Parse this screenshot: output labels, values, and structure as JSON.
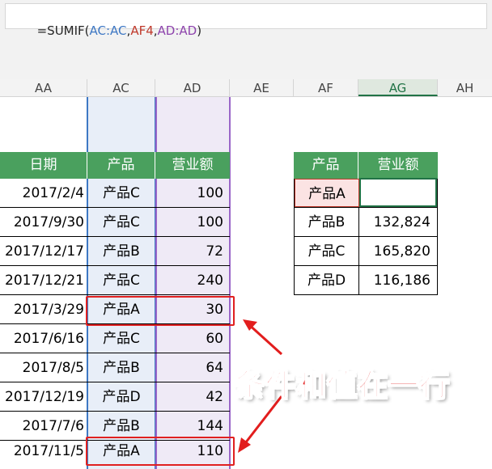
{
  "formula_bar": {
    "parts": [
      {
        "text": "=SUMIF(",
        "color": "#262626"
      },
      {
        "text": "AC:AC",
        "color": "#3e78c4"
      },
      {
        "text": ",",
        "color": "#262626"
      },
      {
        "text": "AF4",
        "color": "#c0392b"
      },
      {
        "text": ",",
        "color": "#262626"
      },
      {
        "text": "AD:AD",
        "color": "#8e44ad"
      },
      {
        "text": ")",
        "color": "#262626"
      }
    ]
  },
  "columns": [
    "AA",
    "AC",
    "AD",
    "AE",
    "AF",
    "AG",
    "AH"
  ],
  "selected_column": "AG",
  "left_table": {
    "headers": [
      "日期",
      "产品",
      "营业额"
    ],
    "rows": [
      {
        "date": "2017/2/4",
        "product": "产品C",
        "value": "100"
      },
      {
        "date": "2017/9/30",
        "product": "产品C",
        "value": "100"
      },
      {
        "date": "2017/12/17",
        "product": "产品B",
        "value": "72"
      },
      {
        "date": "2017/12/21",
        "product": "产品C",
        "value": "240"
      },
      {
        "date": "2017/3/29",
        "product": "产品A",
        "value": "30"
      },
      {
        "date": "2017/6/16",
        "product": "产品C",
        "value": "60"
      },
      {
        "date": "2017/8/5",
        "product": "产品B",
        "value": "64"
      },
      {
        "date": "2017/12/19",
        "product": "产品D",
        "value": "42"
      },
      {
        "date": "2017/7/6",
        "product": "产品B",
        "value": "144"
      },
      {
        "date": "2017/11/5",
        "product": "产品A",
        "value": "110"
      }
    ]
  },
  "right_table": {
    "headers": [
      "产品",
      "营业额"
    ],
    "rows": [
      {
        "product": "产品A",
        "value": ""
      },
      {
        "product": "产品B",
        "value": "132,824"
      },
      {
        "product": "产品C",
        "value": "165,820"
      },
      {
        "product": "产品D",
        "value": "116,186"
      }
    ]
  },
  "annotation": {
    "text": "条件和值在一行",
    "color": "#e21d1d"
  },
  "colors": {
    "header_green": "#4aa05e",
    "selected_cell_border": "#217346",
    "criteria_cell_fill": "#fbe3e3",
    "criteria_cell_border": "#c0392b"
  }
}
